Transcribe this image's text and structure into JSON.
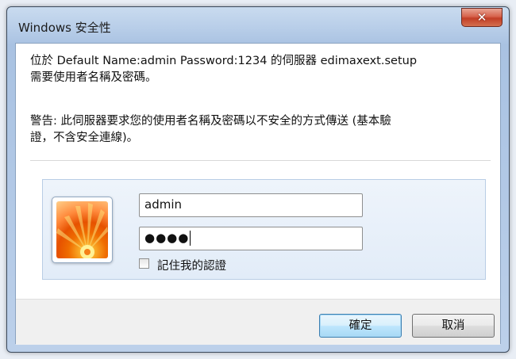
{
  "window": {
    "title": "Windows 安全性",
    "close_symbol": "✕"
  },
  "message": {
    "line1": "位於 Default Name:admin Password:1234 的伺服器 edimaxext.setup",
    "line2": "需要使用者名稱及密碼。",
    "warning_line1": "警告: 此伺服器要求您的使用者名稱及密碼以不安全的方式傳送 (基本驗",
    "warning_line2": "證，不含安全連線)。"
  },
  "credentials": {
    "username_value": "admin",
    "password_mask": "●●●●",
    "remember_label": "記住我的認證",
    "remember_checked": false
  },
  "buttons": {
    "ok_label": "確定",
    "cancel_label": "取消"
  },
  "icons": {
    "close": "close-icon",
    "user_tile": "user-account-picture-flower"
  },
  "colors": {
    "titlebar": "#b7cde8",
    "close_button": "#c13e26",
    "panel": "#e2ecf8",
    "ok_button_border": "#3c7fb1"
  }
}
